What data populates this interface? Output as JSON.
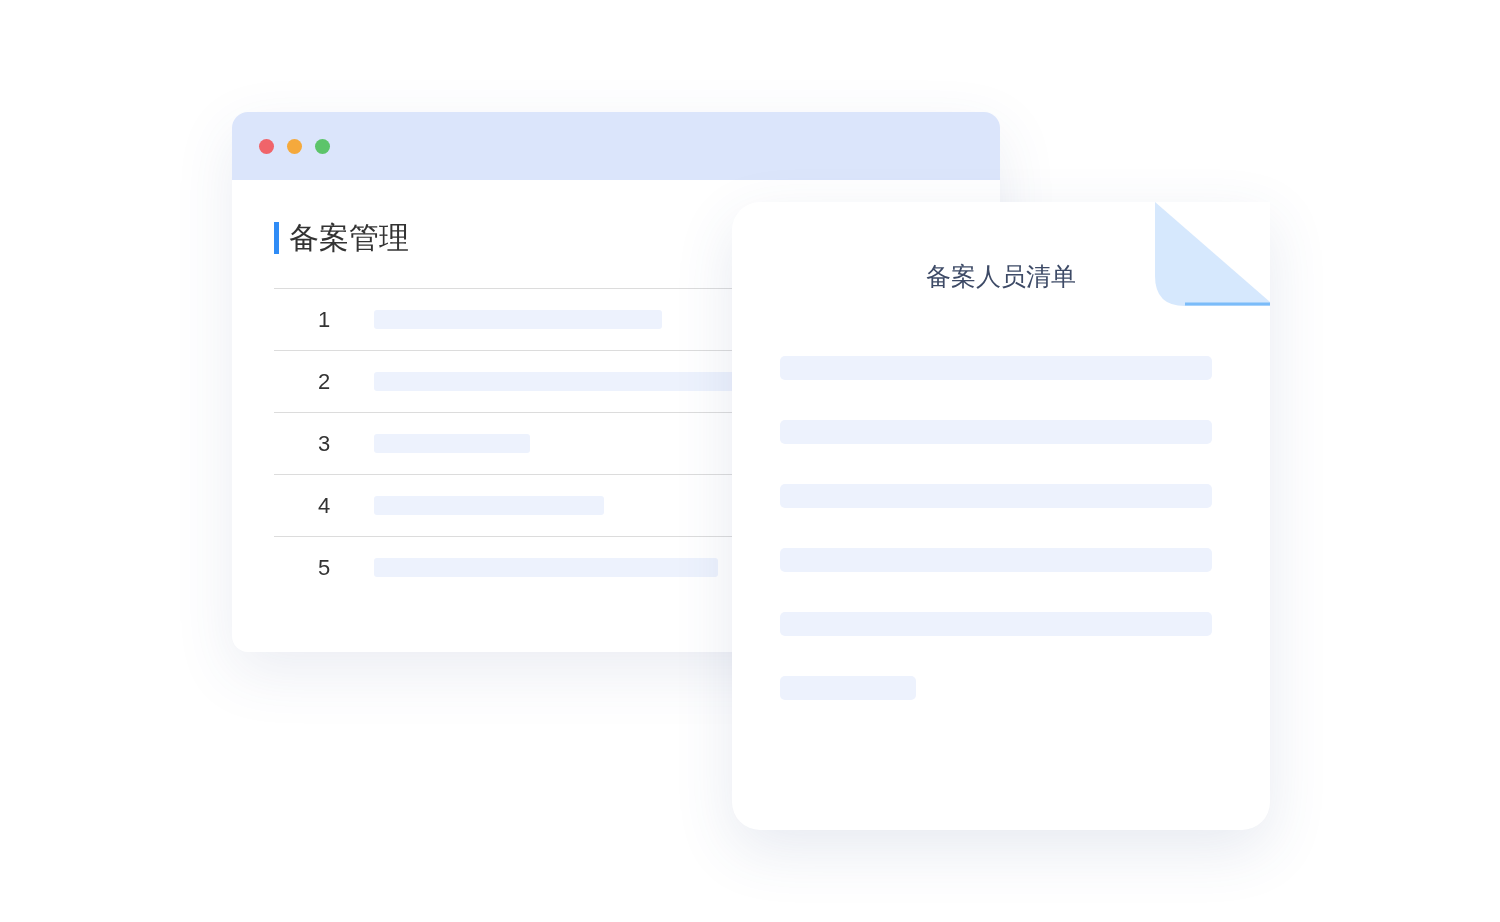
{
  "window": {
    "controls": [
      {
        "color": "#f0646a"
      },
      {
        "color": "#f5a93c"
      },
      {
        "color": "#5cc46a"
      }
    ],
    "title": "备案管理",
    "rows": [
      {
        "number": "1"
      },
      {
        "number": "2"
      },
      {
        "number": "3"
      },
      {
        "number": "4"
      },
      {
        "number": "5"
      }
    ]
  },
  "document": {
    "title": "备案人员清单"
  }
}
